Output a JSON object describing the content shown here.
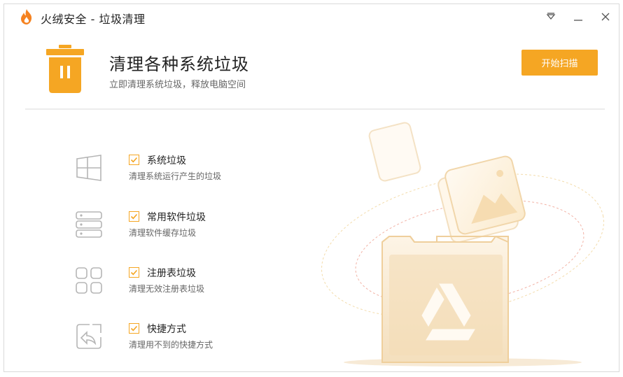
{
  "window": {
    "title": "火绒安全 - 垃圾清理"
  },
  "header": {
    "title": "清理各种系统垃圾",
    "subtitle": "立即清理系统垃圾，释放电脑空间",
    "scan_button": "开始扫描"
  },
  "items": [
    {
      "icon": "windows-icon",
      "title": "系统垃圾",
      "desc": "清理系统运行产生的垃圾",
      "checked": true
    },
    {
      "icon": "database-icon",
      "title": "常用软件垃圾",
      "desc": "清理软件缓存垃圾",
      "checked": true
    },
    {
      "icon": "registry-grid-icon",
      "title": "注册表垃圾",
      "desc": "清理无效注册表垃圾",
      "checked": true
    },
    {
      "icon": "shortcut-icon",
      "title": "快捷方式",
      "desc": "清理用不到的快捷方式",
      "checked": true
    }
  ],
  "colors": {
    "accent": "#f5a623",
    "illustration": "#f0c989"
  }
}
